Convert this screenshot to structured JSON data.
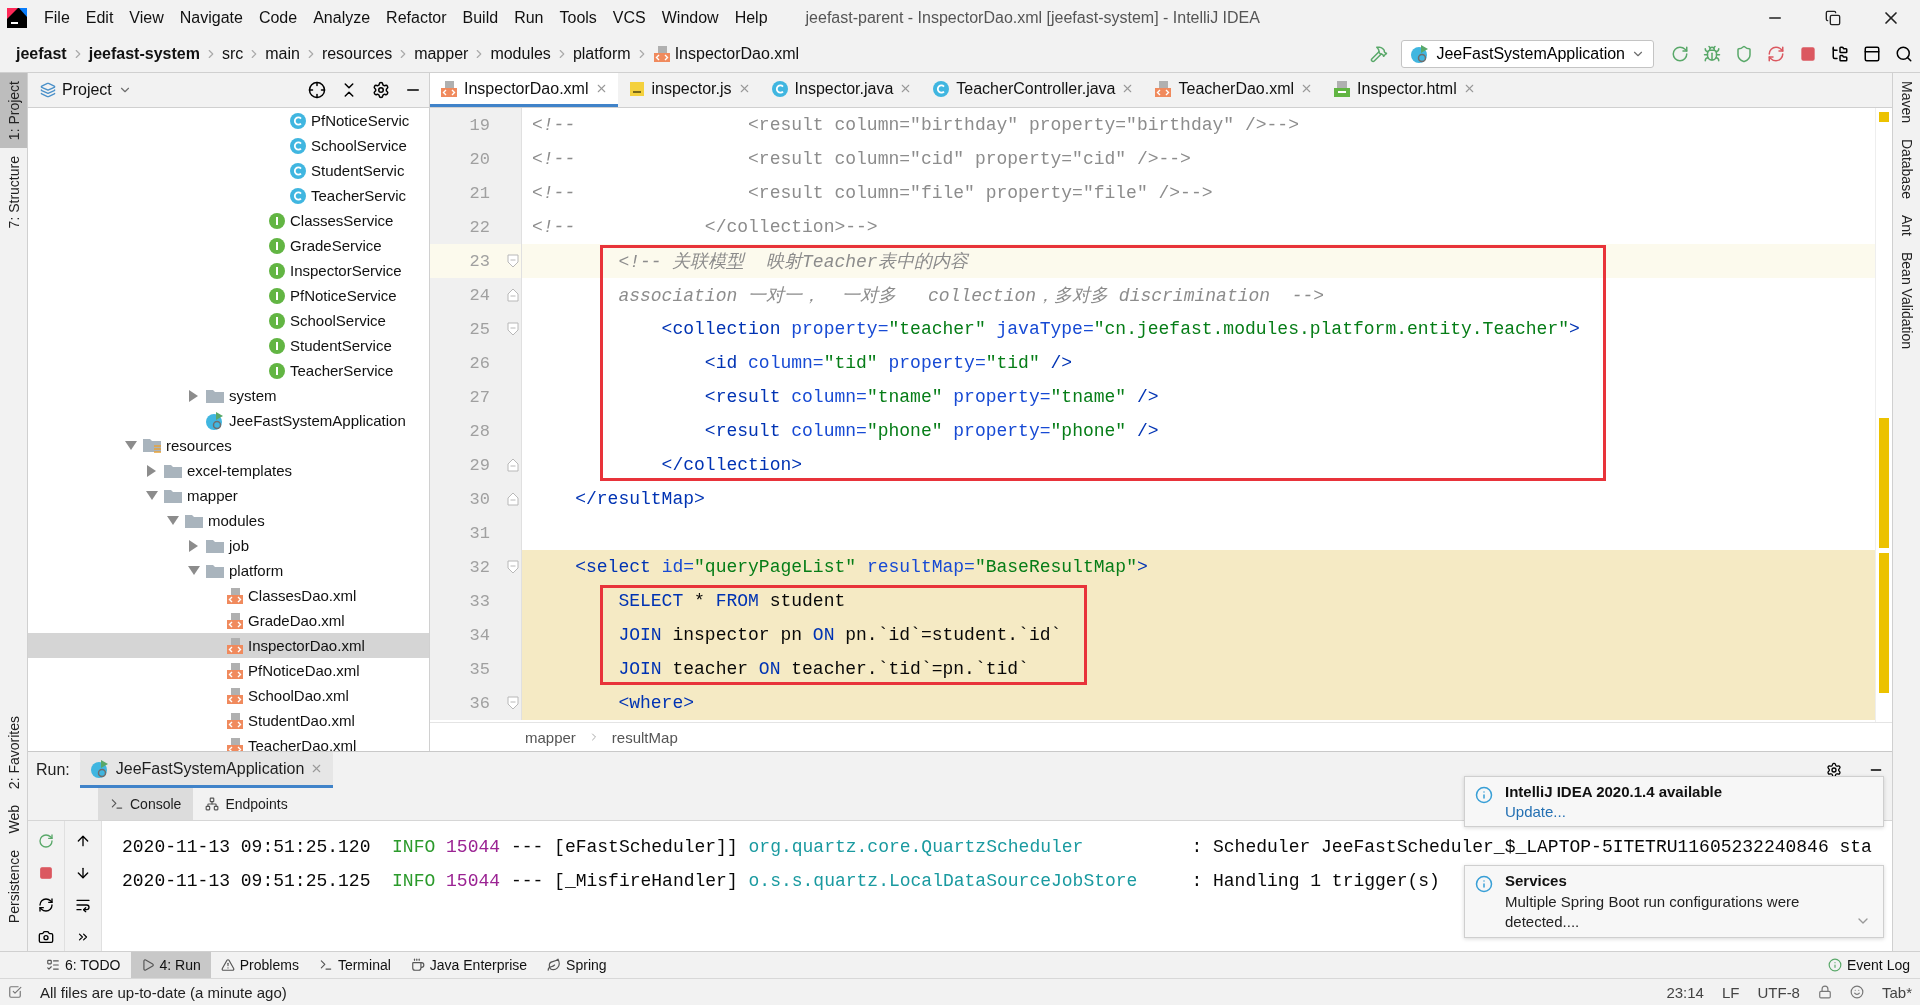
{
  "menu_bar": {
    "items": [
      "File",
      "Edit",
      "View",
      "Navigate",
      "Code",
      "Analyze",
      "Refactor",
      "Build",
      "Run",
      "Tools",
      "VCS",
      "Window",
      "Help"
    ],
    "title": "jeefast-parent - InspectorDao.xml [jeefast-system] - IntelliJ IDEA"
  },
  "navigation_bar": {
    "crumbs": [
      {
        "label": "jeefast",
        "kind": "module"
      },
      {
        "label": "jeefast-system",
        "kind": "module"
      },
      {
        "label": "src",
        "kind": "plain"
      },
      {
        "label": "main",
        "kind": "plain"
      },
      {
        "label": "resources",
        "kind": "plain"
      },
      {
        "label": "mapper",
        "kind": "plain"
      },
      {
        "label": "modules",
        "kind": "plain"
      },
      {
        "label": "platform",
        "kind": "plain"
      },
      {
        "label": "InspectorDao.xml",
        "kind": "xml"
      }
    ],
    "run_configuration": "JeeFastSystemApplication"
  },
  "left_stripe": {
    "top": [
      {
        "label": "1: Project",
        "selected": true
      },
      {
        "label": "7: Structure",
        "selected": false
      }
    ],
    "bottom": [
      {
        "label": "2: Favorites",
        "selected": false
      },
      {
        "label": "Web",
        "selected": false
      },
      {
        "label": "Persistence",
        "selected": false
      }
    ]
  },
  "right_stripe": [
    "Maven",
    "Database",
    "Ant",
    "Bean Validation"
  ],
  "project_panel": {
    "title": "Project",
    "tree": [
      {
        "children": [
          {
            "children": [
              {
                "children": [
                  {
                    "children": [
                      {
                        "children": [
                          {
                            "children": [
                              {
                                "children": [
                                  {
                                    "label": "PfNoticeServic",
                                    "kind": "class",
                                    "selected": false
                                  },
                                  {
                                    "label": "SchoolService",
                                    "kind": "class",
                                    "selected": false
                                  },
                                  {
                                    "label": "StudentServic",
                                    "kind": "class",
                                    "selected": false
                                  },
                                  {
                                    "label": "TeacherServic",
                                    "kind": "class",
                                    "selected": false
                                  }
                                ]
                              },
                              {
                                "label": "ClassesService",
                                "kind": "interface",
                                "selected": false
                              },
                              {
                                "label": "GradeService",
                                "kind": "interface",
                                "selected": false
                              },
                              {
                                "label": "InspectorService",
                                "kind": "interface",
                                "selected": false
                              },
                              {
                                "label": "PfNoticeService",
                                "kind": "interface",
                                "selected": false
                              },
                              {
                                "label": "SchoolService",
                                "kind": "interface",
                                "selected": false
                              },
                              {
                                "label": "StudentService",
                                "kind": "interface",
                                "selected": false
                              },
                              {
                                "label": "TeacherService",
                                "kind": "interface",
                                "selected": false
                              }
                            ]
                          }
                        ]
                      }
                    ]
                  },
                  {
                    "label": "system",
                    "kind": "folder",
                    "expanded": false,
                    "selected": false
                  },
                  {
                    "label": "JeeFastSystemApplication",
                    "kind": "app",
                    "selected": false
                  }
                ]
              }
            ]
          }
        ]
      },
      {
        "label": "resources",
        "kind": "resources",
        "expanded": true,
        "selected": false,
        "children": [
          {
            "label": "excel-templates",
            "kind": "folder",
            "expanded": false,
            "selected": false
          },
          {
            "label": "mapper",
            "kind": "folder",
            "expanded": true,
            "selected": false,
            "children": [
              {
                "label": "modules",
                "kind": "folder",
                "expanded": true,
                "selected": false,
                "children": [
                  {
                    "label": "job",
                    "kind": "folder",
                    "expanded": false,
                    "selected": false
                  },
                  {
                    "label": "platform",
                    "kind": "folder",
                    "expanded": true,
                    "selected": false,
                    "children": [
                      {
                        "label": "ClassesDao.xml",
                        "kind": "xml",
                        "selected": false
                      },
                      {
                        "label": "GradeDao.xml",
                        "kind": "xml",
                        "selected": false
                      },
                      {
                        "label": "InspectorDao.xml",
                        "kind": "xml",
                        "selected": true
                      },
                      {
                        "label": "PfNoticeDao.xml",
                        "kind": "xml",
                        "selected": false
                      },
                      {
                        "label": "SchoolDao.xml",
                        "kind": "xml",
                        "selected": false
                      },
                      {
                        "label": "StudentDao.xml",
                        "kind": "xml",
                        "selected": false
                      },
                      {
                        "label": "TeacherDao.xml",
                        "kind": "xml",
                        "selected": false
                      }
                    ]
                  }
                ]
              }
            ]
          }
        ]
      }
    ]
  },
  "editor": {
    "tabs": [
      {
        "label": "InspectorDao.xml",
        "kind": "xml",
        "selected": true
      },
      {
        "label": "inspector.js",
        "kind": "js",
        "selected": false
      },
      {
        "label": "Inspector.java",
        "kind": "class",
        "selected": false
      },
      {
        "label": "TeacherController.java",
        "kind": "class",
        "selected": false
      },
      {
        "label": "TeacherDao.xml",
        "kind": "xml",
        "selected": false
      },
      {
        "label": "Inspector.html",
        "kind": "html",
        "selected": false
      }
    ],
    "lines": [
      {
        "number": "19",
        "tokens": [
          {
            "kind": "comment",
            "text": "<!--"
          },
          {
            "kind": "commented",
            "text": "                <result column=\"birthday\" property=\"birthday\" />-->"
          }
        ]
      },
      {
        "number": "20",
        "tokens": [
          {
            "kind": "comment",
            "text": "<!--"
          },
          {
            "kind": "commented",
            "text": "                <result column=\"cid\" property=\"cid\" />-->"
          }
        ]
      },
      {
        "number": "21",
        "tokens": [
          {
            "kind": "comment",
            "text": "<!--"
          },
          {
            "kind": "commented",
            "text": "                <result column=\"file\" property=\"file\" />-->"
          }
        ]
      },
      {
        "number": "22",
        "tokens": [
          {
            "kind": "comment",
            "text": "<!--"
          },
          {
            "kind": "commented",
            "text": "            </collection>-->"
          }
        ]
      },
      {
        "number": "23",
        "caret_line": true,
        "boxed": true,
        "fold_start": true,
        "tokens": [
          {
            "kind": "comment",
            "text": "        <!-- 关联模型  映射Teacher表中的内容"
          }
        ]
      },
      {
        "number": "24",
        "boxed": true,
        "fold_end": true,
        "tokens": [
          {
            "kind": "comment",
            "text": "        association 一对一，  一对多   collection，多对多 discrimination  -->"
          }
        ]
      },
      {
        "number": "25",
        "boxed": true,
        "fold_start": true,
        "tokens": [
          {
            "kind": "tag",
            "text": "            <collection"
          },
          {
            "kind": "attr",
            "text": " property="
          },
          {
            "kind": "value",
            "text": "\"teacher\""
          },
          {
            "kind": "attr",
            "text": " javaType="
          },
          {
            "kind": "value",
            "text": "\"cn.jeefast.modules.platform.entity.Teacher\""
          },
          {
            "kind": "tag",
            "text": ">"
          }
        ]
      },
      {
        "number": "26",
        "boxed": true,
        "tokens": [
          {
            "kind": "tag",
            "text": "                <id"
          },
          {
            "kind": "attr",
            "text": " column="
          },
          {
            "kind": "value",
            "text": "\"tid\""
          },
          {
            "kind": "attr",
            "text": " property="
          },
          {
            "kind": "value",
            "text": "\"tid\""
          },
          {
            "kind": "tag",
            "text": " />"
          }
        ]
      },
      {
        "number": "27",
        "boxed": true,
        "tokens": [
          {
            "kind": "tag",
            "text": "                <result"
          },
          {
            "kind": "attr",
            "text": " column="
          },
          {
            "kind": "value",
            "text": "\"tname\""
          },
          {
            "kind": "attr",
            "text": " property="
          },
          {
            "kind": "value",
            "text": "\"tname\""
          },
          {
            "kind": "tag",
            "text": " />"
          }
        ]
      },
      {
        "number": "28",
        "boxed": true,
        "tokens": [
          {
            "kind": "tag",
            "text": "                <result"
          },
          {
            "kind": "attr",
            "text": " column="
          },
          {
            "kind": "value",
            "text": "\"phone\""
          },
          {
            "kind": "attr",
            "text": " property="
          },
          {
            "kind": "value",
            "text": "\"phone\""
          },
          {
            "kind": "tag",
            "text": " />"
          }
        ]
      },
      {
        "number": "29",
        "boxed": true,
        "fold_end": true,
        "tokens": [
          {
            "kind": "tag",
            "text": "            </collection>"
          }
        ]
      },
      {
        "number": "30",
        "fold_end": true,
        "tokens": [
          {
            "kind": "tag",
            "text": "    </resultMap>"
          }
        ]
      },
      {
        "number": "31"
      },
      {
        "number": "32",
        "in_block": true,
        "fold_start": true,
        "tokens": [
          {
            "kind": "tag",
            "text": "    <select"
          },
          {
            "kind": "attr",
            "text": " id="
          },
          {
            "kind": "value",
            "text": "\"queryPageList\""
          },
          {
            "kind": "attr",
            "text": " resultMap="
          },
          {
            "kind": "value",
            "text": "\"BaseResultMap\""
          },
          {
            "kind": "tag",
            "text": ">"
          }
        ]
      },
      {
        "number": "33",
        "in_block": true,
        "boxed": true,
        "tokens": [
          {
            "kind": "keyword",
            "text": "        SELECT"
          },
          {
            "kind": "text",
            "text": " * "
          },
          {
            "kind": "keyword",
            "text": "FROM"
          },
          {
            "kind": "text",
            "text": " student"
          }
        ]
      },
      {
        "number": "34",
        "in_block": true,
        "boxed": true,
        "tokens": [
          {
            "kind": "keyword",
            "text": "        JOIN"
          },
          {
            "kind": "text",
            "text": " inspector pn "
          },
          {
            "kind": "keyword",
            "text": "ON"
          },
          {
            "kind": "text",
            "text": " pn.`id`=student.`id`"
          }
        ]
      },
      {
        "number": "35",
        "in_block": true,
        "boxed": true,
        "tokens": [
          {
            "kind": "keyword",
            "text": "        JOIN"
          },
          {
            "kind": "text",
            "text": " teacher "
          },
          {
            "kind": "keyword",
            "text": "ON"
          },
          {
            "kind": "text",
            "text": " teacher.`tid`=pn.`tid`"
          }
        ]
      },
      {
        "number": "36",
        "in_block": true,
        "fold_start": true,
        "tokens": [
          {
            "kind": "tag",
            "text": "        <where>"
          }
        ]
      }
    ],
    "breadcrumbs": [
      "mapper",
      "resultMap"
    ]
  },
  "run_panel": {
    "label": "Run:",
    "tab": "JeeFastSystemApplication",
    "subtabs": [
      {
        "label": "Console",
        "kind": "console",
        "selected": true
      },
      {
        "label": "Endpoints",
        "kind": "endpoints",
        "selected": false
      }
    ],
    "log": [
      [
        {
          "kind": "text",
          "text": "2020-11-13 09:51:25.120  "
        },
        {
          "kind": "level",
          "text": "INFO"
        },
        {
          "kind": "pid",
          "text": " 15044"
        },
        {
          "kind": "text",
          "text": " --- [eFastScheduler]] "
        },
        {
          "kind": "logger",
          "text": "org.quartz.core.QuartzScheduler         "
        },
        {
          "kind": "text",
          "text": " : Scheduler JeeFastScheduler_$_LAPTOP-5ITETRU11605232240846 sta"
        }
      ],
      [
        {
          "kind": "text",
          "text": "2020-11-13 09:51:25.125  "
        },
        {
          "kind": "level",
          "text": "INFO"
        },
        {
          "kind": "pid",
          "text": " 15044"
        },
        {
          "kind": "text",
          "text": " --- [_MisfireHandler] "
        },
        {
          "kind": "logger",
          "text": "o.s.s.quartz.LocalDataSourceJobStore    "
        },
        {
          "kind": "text",
          "text": " : Handling 1 trigger(s)"
        }
      ]
    ],
    "notifications": [
      {
        "title": "IntelliJ IDEA 2020.1.4 available",
        "link": "Update..."
      },
      {
        "title": "Services",
        "body": "Multiple Spring Boot run configurations were detected...."
      }
    ]
  },
  "tool_tabs": {
    "left": [
      {
        "label": "6: TODO",
        "kind": "todo",
        "selected": false
      },
      {
        "label": "4: Run",
        "kind": "run",
        "selected": true
      },
      {
        "label": "Problems",
        "kind": "problems",
        "selected": false
      },
      {
        "label": "Terminal",
        "kind": "terminal",
        "selected": false
      },
      {
        "label": "Java Enterprise",
        "kind": "enterprise",
        "selected": false
      },
      {
        "label": "Spring",
        "kind": "spring",
        "selected": false
      }
    ],
    "right": "Event Log"
  },
  "status_bar": {
    "message": "All files are up-to-date (a minute ago)",
    "position": "23:14",
    "line_separator": "LF",
    "encoding": "UTF-8",
    "indent": "Tab*"
  }
}
